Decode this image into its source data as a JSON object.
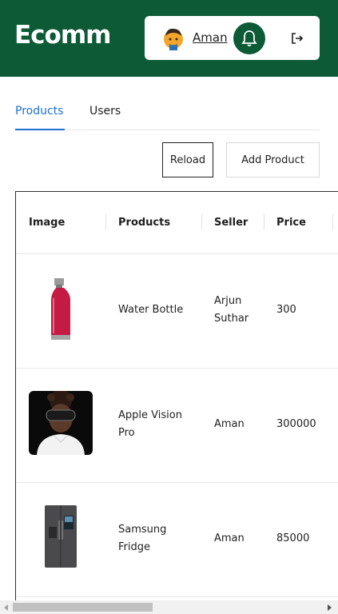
{
  "header": {
    "logo": "Ecomm",
    "username": "Aman"
  },
  "tabs": [
    {
      "label": "Products",
      "active": true
    },
    {
      "label": "Users",
      "active": false
    }
  ],
  "actions": {
    "reload_label": "Reload",
    "add_label": "Add Product"
  },
  "table": {
    "columns": [
      "Image",
      "Products",
      "Seller",
      "Price"
    ],
    "rows": [
      {
        "image_icon": "water-bottle-image",
        "product_line1": "Water Bottle",
        "product_line2": "",
        "seller_line1": "Arjun",
        "seller_line2": "Suthar",
        "price": "300"
      },
      {
        "image_icon": "vision-pro-image",
        "product_line1": "Apple Vision",
        "product_line2": "Pro",
        "seller_line1": "Aman",
        "seller_line2": "",
        "price": "300000"
      },
      {
        "image_icon": "fridge-image",
        "product_line1": "Samsung",
        "product_line2": "Fridge",
        "seller_line1": "Aman",
        "seller_line2": "",
        "price": "85000"
      }
    ]
  },
  "colors": {
    "brand": "#0d5a37",
    "accent": "#1e6fd1"
  },
  "icons": {
    "avatar": "person-avatar-icon",
    "notification": "bell-icon",
    "logout": "logout-icon"
  }
}
